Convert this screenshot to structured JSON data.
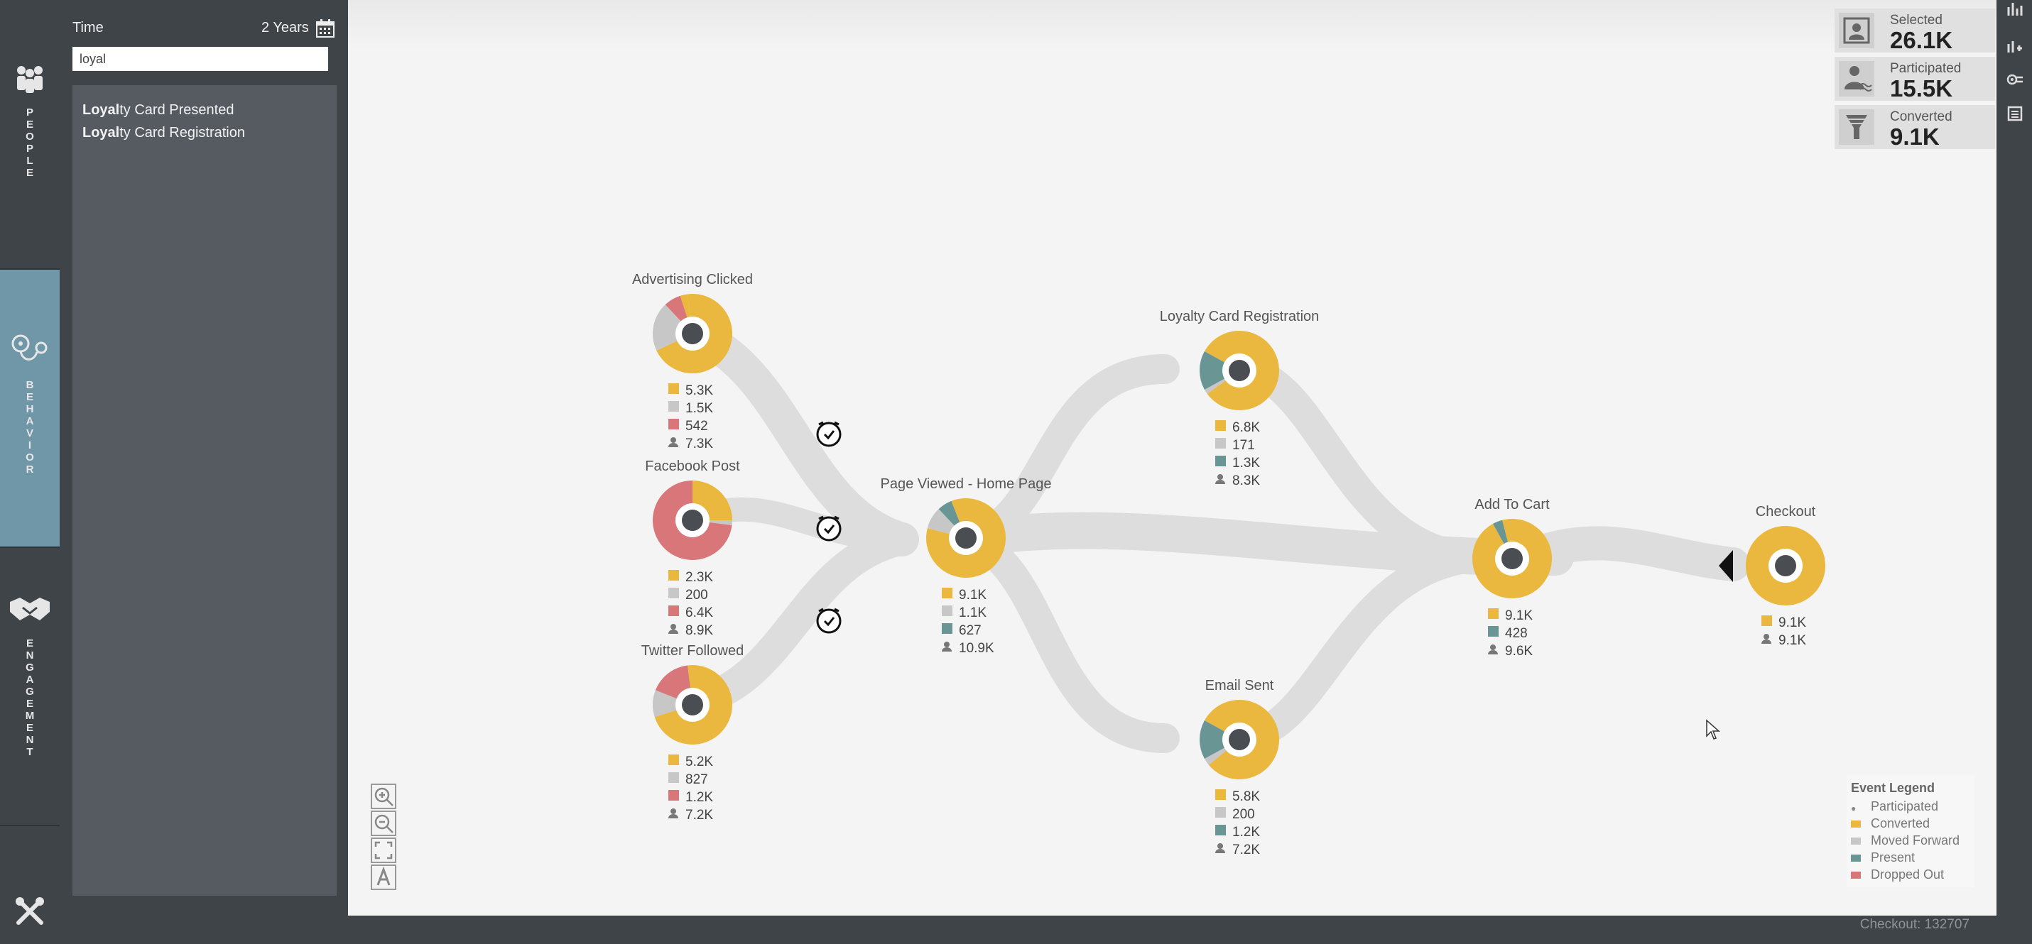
{
  "nav": {
    "sections": [
      {
        "label": "PEOPLE",
        "icon": "people-icon"
      },
      {
        "label": "BEHAVIOR",
        "icon": "behavior-icon"
      },
      {
        "label": "ENGAGEMENT",
        "icon": "handshake-icon"
      }
    ],
    "bottom_icon": "tools-icon"
  },
  "filter": {
    "time_label": "Time",
    "time_value": "2 Years",
    "search_value": "loyal",
    "results": [
      {
        "match": "Loyal",
        "rest": "ty Card Presented"
      },
      {
        "match": "Loyal",
        "rest": "ty Card Registration"
      }
    ]
  },
  "people": {
    "header": "People",
    "items": [
      {
        "label": "Selected",
        "value": "26.1K",
        "icon": "person-card-icon"
      },
      {
        "label": "Participated",
        "value": "15.5K",
        "icon": "person-wave-icon"
      },
      {
        "label": "Converted",
        "value": "9.1K",
        "icon": "funnel-icon"
      }
    ]
  },
  "colors": {
    "converted": "#eab83e",
    "moved_forward": "#c7c7c7",
    "present": "#6a9595",
    "dropped_out": "#d9767a",
    "flow": "#dddddd",
    "center": "#4a4e52"
  },
  "nodes": [
    {
      "title": "Advertising Clicked",
      "stats": [
        "5.3K",
        "1.5K",
        "542",
        "7.3K"
      ],
      "stat_types": [
        "converted",
        "moved_forward",
        "dropped_out",
        "participated"
      ]
    },
    {
      "title": "Facebook Post",
      "stats": [
        "2.3K",
        "200",
        "6.4K",
        "8.9K"
      ],
      "stat_types": [
        "converted",
        "moved_forward",
        "dropped_out",
        "participated"
      ]
    },
    {
      "title": "Twitter Followed",
      "stats": [
        "5.2K",
        "827",
        "1.2K",
        "7.2K"
      ],
      "stat_types": [
        "converted",
        "moved_forward",
        "dropped_out",
        "participated"
      ]
    },
    {
      "title": "Page Viewed - Home Page",
      "stats": [
        "9.1K",
        "1.1K",
        "627",
        "10.9K"
      ],
      "stat_types": [
        "converted",
        "moved_forward",
        "present",
        "participated"
      ]
    },
    {
      "title": "Loyalty Card Registration",
      "stats": [
        "6.8K",
        "171",
        "1.3K",
        "8.3K"
      ],
      "stat_types": [
        "converted",
        "moved_forward",
        "present",
        "participated"
      ]
    },
    {
      "title": "Email Sent",
      "stats": [
        "5.8K",
        "200",
        "1.2K",
        "7.2K"
      ],
      "stat_types": [
        "converted",
        "moved_forward",
        "present",
        "participated"
      ]
    },
    {
      "title": "Add To Cart",
      "stats": [
        "9.1K",
        "428",
        "9.6K"
      ],
      "stat_types": [
        "converted",
        "present",
        "participated"
      ]
    },
    {
      "title": "Checkout",
      "stats": [
        "9.1K",
        "9.1K"
      ],
      "stat_types": [
        "converted",
        "participated"
      ]
    }
  ],
  "legend": {
    "title": "Event Legend",
    "items": [
      {
        "label": "Participated",
        "type": "participated"
      },
      {
        "label": "Converted",
        "type": "converted"
      },
      {
        "label": "Moved Forward",
        "type": "moved_forward"
      },
      {
        "label": "Present",
        "type": "present"
      },
      {
        "label": "Dropped Out",
        "type": "dropped_out"
      }
    ]
  },
  "zoom_tools": [
    "zoom-in-icon",
    "zoom-out-icon",
    "fit-screen-icon",
    "label-toggle-icon"
  ],
  "status": "Checkout: 132707"
}
